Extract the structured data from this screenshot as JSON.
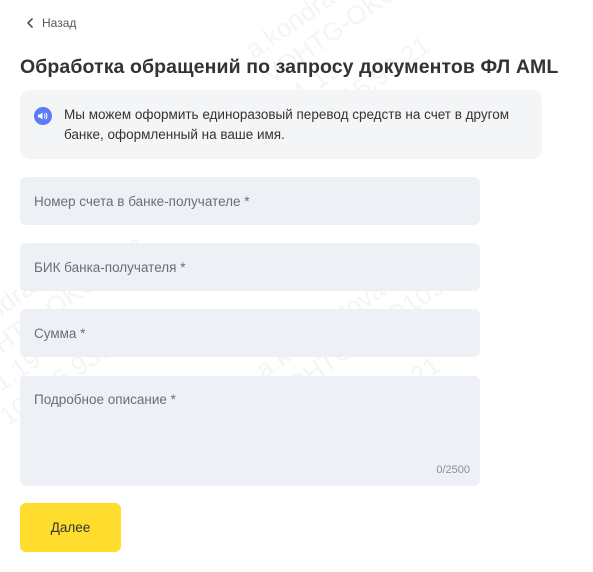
{
  "back": {
    "label": "Назад",
    "icon": "chevron-left-icon"
  },
  "title": "Обработка обращений по запросу документов ФЛ AML",
  "notice": {
    "icon": "speaker-icon",
    "icon_color": "#5a7df5",
    "text": "Мы можем оформить единоразовый перевод средств на счет в другом банке, оформленный на ваше имя."
  },
  "form": {
    "account_placeholder": "Номер счета в банке-получателе *",
    "bik_placeholder": "БИК банка-получателя *",
    "amount_placeholder": "Сумма *",
    "description_placeholder": "Подробное описание *",
    "description_counter": "0/2500"
  },
  "actions": {
    "next_label": "Далее",
    "next_color": "#ffdd2d"
  },
  "watermark": {
    "text": "a.kondratova\nVDHTG-OKO1096\n21.19\n10.215.93.21"
  }
}
